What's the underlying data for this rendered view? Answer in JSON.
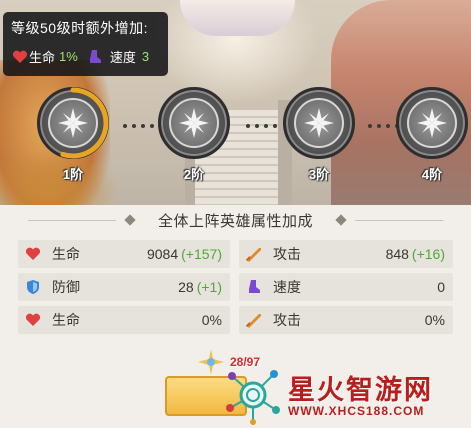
{
  "bonus_tooltip": {
    "title": "等级50级时额外增加:",
    "stats": [
      {
        "icon": "heart-icon",
        "label": "生命",
        "value": "1%"
      },
      {
        "icon": "boot-icon",
        "label": "速度",
        "value": "3"
      }
    ]
  },
  "stages": [
    {
      "label": "1阶",
      "progress_ring": 0.55
    },
    {
      "label": "2阶"
    },
    {
      "label": "3阶"
    },
    {
      "label": "4阶"
    }
  ],
  "panel": {
    "title": "全体上阵英雄属性加成",
    "attributes": [
      {
        "icon": "heart-icon",
        "name": "生命",
        "value": "9084",
        "increase": "(+157)"
      },
      {
        "icon": "sword-icon",
        "name": "攻击",
        "value": "848",
        "increase": "(+16)"
      },
      {
        "icon": "shield-icon",
        "name": "防御",
        "value": "28",
        "increase": "(+1)"
      },
      {
        "icon": "boot-icon",
        "name": "速度",
        "value": "0",
        "increase": ""
      },
      {
        "icon": "heart-icon",
        "name": "生命",
        "value": "0%",
        "increase": ""
      },
      {
        "icon": "sword-icon",
        "name": "攻击",
        "value": "0%",
        "increase": ""
      }
    ]
  },
  "material_progress": "28/97",
  "watermark": {
    "title": "星火智游网",
    "url": "WWW.XHCS188.COM"
  },
  "colors": {
    "increase_green": "#4fa83a",
    "progress_red": "#d62b2b",
    "ring_gold": "#e8a423",
    "heart_red": "#e0413f",
    "shield_blue": "#3b86d6",
    "boot_purple": "#7a4bd1",
    "sword_orange": "#e38a2a"
  }
}
